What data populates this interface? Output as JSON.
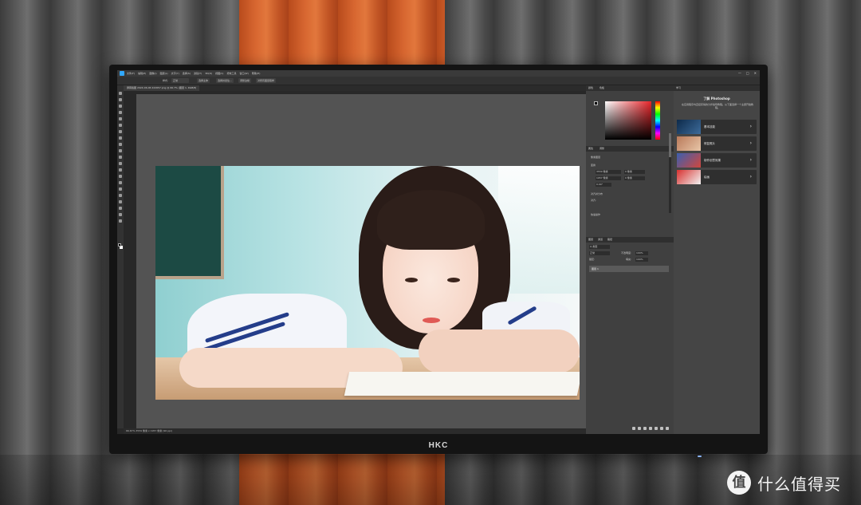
{
  "monitor": {
    "brand": "HKC"
  },
  "photoshop": {
    "menu": [
      "文件(F)",
      "编辑(E)",
      "图像(I)",
      "图层(L)",
      "文字(Y)",
      "选择(S)",
      "滤镜(T)",
      "3D(D)",
      "视图(V)",
      "增效工具",
      "窗口(W)",
      "帮助(H)"
    ],
    "options": {
      "style_label": "样式:",
      "style_value": "正常",
      "select_subject": "选择主体",
      "select_and_mask": "选择并遮住...",
      "refine_edge": "调整边缘",
      "sample_all_layers": "对所有图层取样"
    },
    "doc_tab": "屏幕截图 2024-06-06 222657.png @ 66.7% (图层 1, RGB/8)",
    "status_bar": "66.67%    3559 像素 x 1957 像素 (96 ppi)",
    "panels": {
      "color_tab": "颜色",
      "swatches_tab": "色板",
      "properties_tab": "属性",
      "adjustments_tab": "调整",
      "layer_properties": "像素图层",
      "transform_label": "变换",
      "w_value": "3559 像素",
      "h_value": "1957 像素",
      "x_value": "0 像素",
      "y_value": "0 像素",
      "angle_value": "0.00°",
      "align_label": "对齐并分布",
      "align_sub": "对齐:",
      "quick_actions": "快速操作",
      "layers_tab": "图层",
      "channels_tab": "通道",
      "paths_tab": "路径",
      "kind_filter": "Q 类型",
      "blend_mode": "正常",
      "opacity_label": "不透明度:",
      "opacity_value": "100%",
      "lock_label": "锁定:",
      "fill_label": "填充:",
      "fill_value": "100%",
      "layer_name": "图层 1"
    },
    "learn": {
      "tab": "学习",
      "title": "了解 Photoshop",
      "description": "在应用程序内直接获得的分步指导教程。从下面选择一个主题开始教程。",
      "cards": [
        {
          "label": "基本技能"
        },
        {
          "label": "修复照片"
        },
        {
          "label": "制作创意效果"
        },
        {
          "label": "绘画"
        }
      ]
    }
  },
  "watermark": {
    "glyph": "值",
    "text": "什么值得买"
  }
}
